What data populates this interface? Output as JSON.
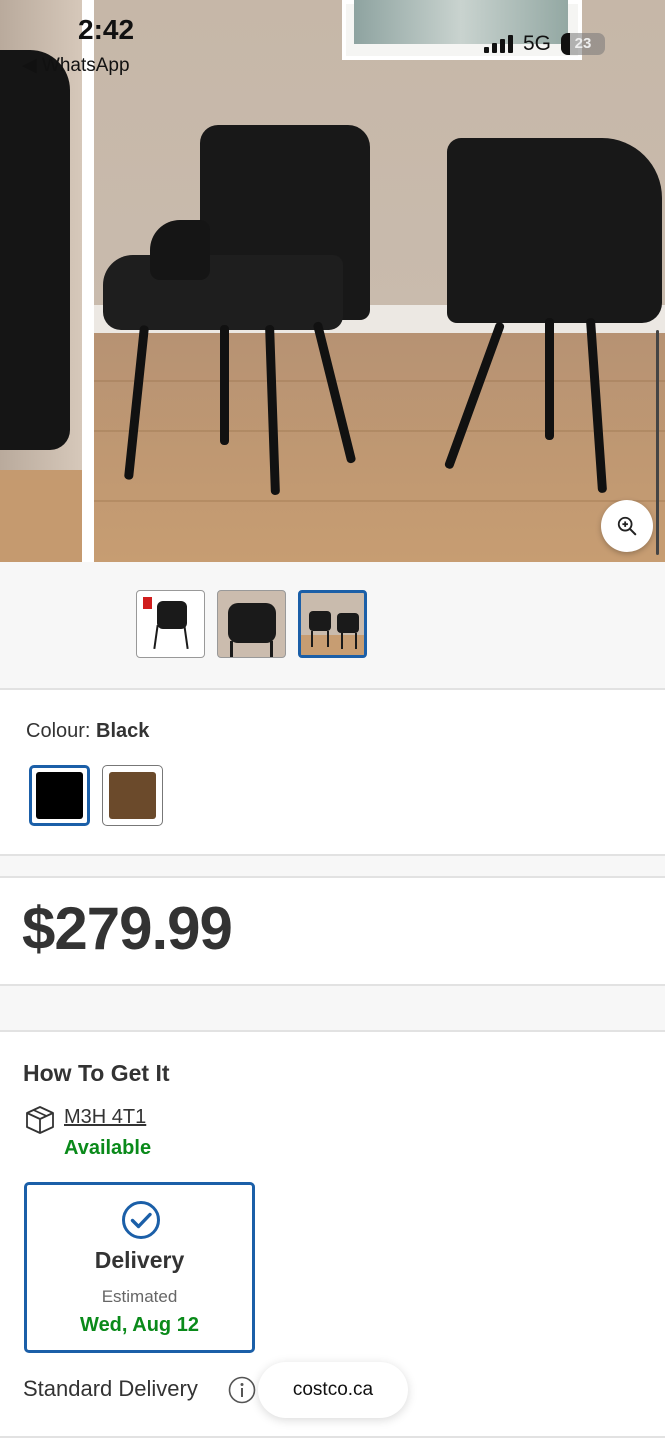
{
  "status_bar": {
    "time": "2:42",
    "back_app": "WhatsApp",
    "network": "5G",
    "battery": "23"
  },
  "product": {
    "thumbnails": [
      {
        "label": "chair-thumbnail-1"
      },
      {
        "label": "chair-thumbnail-2"
      },
      {
        "label": "chair-thumbnail-3",
        "selected": true
      }
    ],
    "colour_label": "Colour:",
    "colour_value": "Black",
    "swatches": [
      {
        "name": "Black",
        "color": "#000000",
        "selected": true
      },
      {
        "name": "Brown",
        "color": "#6b4a2b",
        "selected": false
      }
    ],
    "price": "$279.99"
  },
  "how_to_get_it": {
    "title": "How To Get It",
    "postal_code": "M3H 4T1",
    "availability": "Available",
    "delivery_card": {
      "title": "Delivery",
      "estimated_label": "Estimated",
      "date": "Wed, Aug 12"
    },
    "standard_delivery": "Standard Delivery"
  },
  "browser": {
    "url": "costco.ca"
  },
  "colors": {
    "accent": "#1b5fa8",
    "available_green": "#0a8a1a",
    "text": "#333333"
  }
}
